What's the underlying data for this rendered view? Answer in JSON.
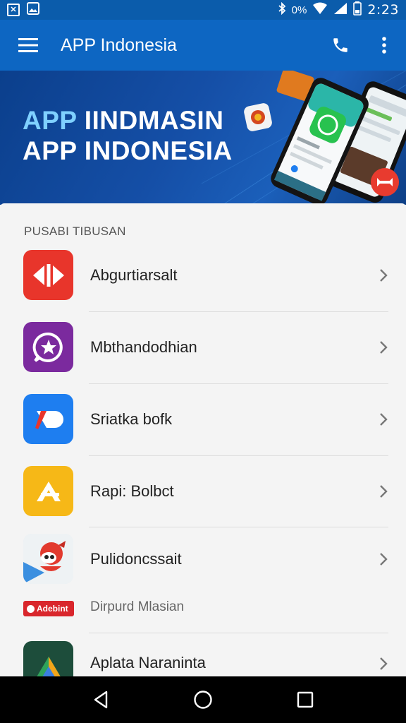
{
  "status_bar": {
    "time": "2:23",
    "battery_text": "0%",
    "icons": [
      "notification-icon",
      "image-icon",
      "bluetooth-icon",
      "wifi-icon",
      "signal-icon",
      "battery-icon"
    ]
  },
  "app_bar": {
    "title": "APP Indonesia",
    "icons": [
      "menu-icon",
      "phone-icon",
      "more-vert-icon"
    ]
  },
  "banner": {
    "line1": "APP IINDMASIN",
    "line2": "APP INDONESIA",
    "colors": {
      "accent": "#7fd0ff",
      "bg": "#154fa7"
    }
  },
  "list": {
    "header": "PUSABI TIBUSAN",
    "items": [
      {
        "label": "Abgurtiarsalt",
        "icon": "red-media-icon",
        "color": "#e8352b"
      },
      {
        "label": "Mbthandodhian",
        "icon": "purple-chat-icon",
        "color": "#7b2a9e"
      },
      {
        "label": "Sriatka bofk",
        "icon": "blue-pen-icon",
        "color": "#1e7ef0"
      },
      {
        "label": "Rapi: Bolbct",
        "icon": "yellow-a-icon",
        "color": "#f6b817"
      },
      {
        "label": "Pulidoncssait",
        "icon": "cartoon-mascot-icon",
        "color": "#dfe8ef"
      },
      {
        "label": "Aplata Naraninta",
        "icon": "triangle-logo-icon",
        "color": "#1d4d3b"
      }
    ],
    "sub_row": {
      "badge": "Adebint",
      "label": "Dirpurd Mlasian",
      "color": "#d9262c"
    }
  },
  "nav_bar": {
    "icons": [
      "back-icon",
      "home-icon",
      "recents-icon"
    ]
  }
}
